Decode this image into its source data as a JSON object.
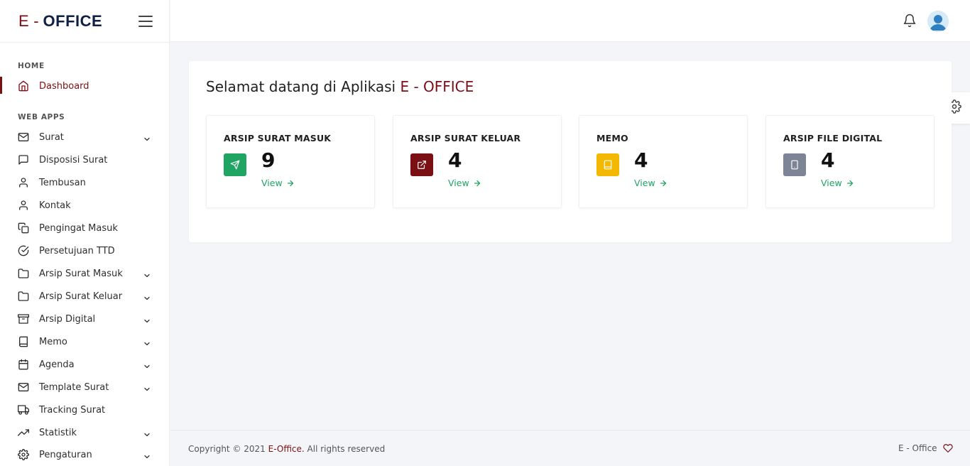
{
  "brand": {
    "e": "E",
    "dash": "-",
    "office": "OFFICE"
  },
  "sidebar": {
    "home_heading": "HOME",
    "webapps_heading": "WEB APPS",
    "items": [
      {
        "label": "Dashboard",
        "icon": "home-icon"
      },
      {
        "label": "Surat",
        "icon": "mail-icon",
        "expandable": true
      },
      {
        "label": "Disposisi Surat",
        "icon": "message-square-icon"
      },
      {
        "label": "Tembusan",
        "icon": "user-icon"
      },
      {
        "label": "Kontak",
        "icon": "user-icon"
      },
      {
        "label": "Pengingat Masuk",
        "icon": "copy-icon"
      },
      {
        "label": "Persetujuan TTD",
        "icon": "check-circle-icon"
      },
      {
        "label": "Arsip Surat Masuk",
        "icon": "folder-icon",
        "expandable": true
      },
      {
        "label": "Arsip Surat Keluar",
        "icon": "folder-icon",
        "expandable": true
      },
      {
        "label": "Arsip Digital",
        "icon": "archive-icon",
        "expandable": true
      },
      {
        "label": "Memo",
        "icon": "book-icon",
        "expandable": true
      },
      {
        "label": "Agenda",
        "icon": "calendar-icon",
        "expandable": true
      },
      {
        "label": "Template Surat",
        "icon": "mail-icon",
        "expandable": true
      },
      {
        "label": "Tracking Surat",
        "icon": "truck-icon"
      },
      {
        "label": "Statistik",
        "icon": "trending-up-icon",
        "expandable": true
      },
      {
        "label": "Pengaturan",
        "icon": "settings-icon",
        "expandable": true
      }
    ]
  },
  "main": {
    "welcome_prefix": "Selamat datang di Aplikasi ",
    "welcome_brand": "E - OFFICE",
    "stats": [
      {
        "title": "ARSIP SURAT MASUK",
        "count": "9",
        "view": "View",
        "icon": "send-icon",
        "color": "#1fa463"
      },
      {
        "title": "ARSIP SURAT KELUAR",
        "count": "4",
        "view": "View",
        "icon": "external-link-icon",
        "color": "#7a0f14"
      },
      {
        "title": "MEMO",
        "count": "4",
        "view": "View",
        "icon": "book-icon",
        "color": "#f5b800"
      },
      {
        "title": "ARSIP FILE DIGITAL",
        "count": "4",
        "view": "View",
        "icon": "tablet-icon",
        "color": "#7d8495"
      }
    ]
  },
  "footer": {
    "copy_prefix": "Copyright © 2021 ",
    "copy_link": "E-Office.",
    "copy_suffix": " All rights reserved",
    "right_text": "E - Office"
  },
  "colors": {
    "brand_red": "#7a0f14",
    "brand_navy": "#0f2047",
    "success": "#1fa463"
  }
}
